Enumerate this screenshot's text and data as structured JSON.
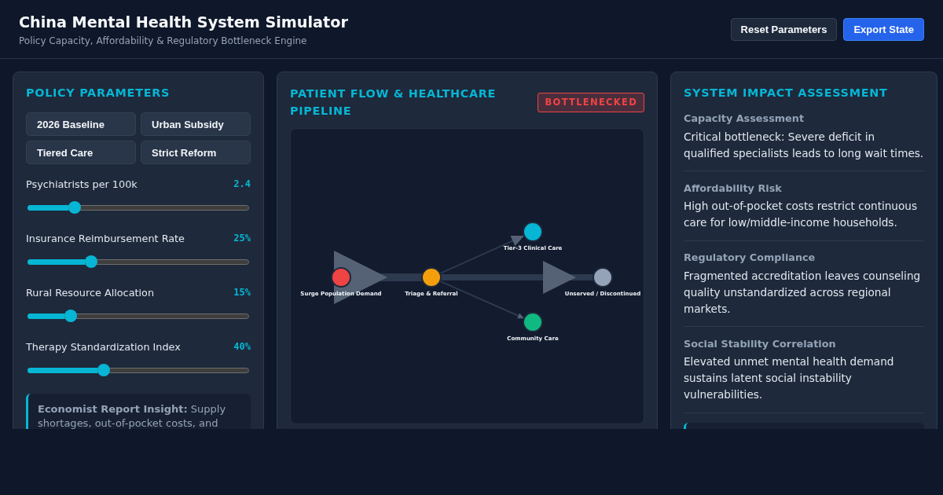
{
  "header": {
    "title": "China Mental Health System Simulator",
    "subtitle": "Policy Capacity, Affordability & Regulatory Bottleneck Engine",
    "buttons": [
      {
        "label": "Reset Parameters",
        "kind": "secondary"
      },
      {
        "label": "Export State",
        "kind": "primary"
      }
    ]
  },
  "policy_parameters": {
    "title": "POLICY PARAMETERS",
    "presets": [
      "2026 Baseline",
      "Urban Subsidy",
      "Tiered Care",
      "Strict Reform"
    ],
    "sliders": [
      {
        "label": "Psychiatrists per 100k",
        "reading": "2.4",
        "level": 0.2
      },
      {
        "label": "Insurance Reimbursement Rate",
        "reading": "25%",
        "level": 0.28
      },
      {
        "label": "Rural Resource Allocation",
        "reading": "15%",
        "level": 0.18
      },
      {
        "label": "Therapy Standardization Index",
        "reading": "40%",
        "level": 0.34
      }
    ],
    "insight": "**Economist Report Insight:** Supply shortages, out-of-pocket costs, and"
  },
  "patient_flow": {
    "title": "PATIENT FLOW & HEALTHCARE PIPELINE",
    "status": {
      "label": "BOTTLENECKED",
      "kind": "critical"
    },
    "nodes": [
      {
        "label": "Surge Population Demand",
        "color": "#ef4444"
      },
      {
        "label": "Triage & Referral",
        "color": "#f59e0b"
      },
      {
        "label": "Tier-3 Clinical Care",
        "color": "#06b6d4"
      },
      {
        "label": "Community Care",
        "color": "#10b981"
      },
      {
        "label": "Unserved / Discontinued",
        "color": "#94a3b8"
      }
    ],
    "links": [
      {
        "kind": "heavy"
      },
      {
        "kind": "light"
      },
      {
        "kind": "light"
      },
      {
        "kind": "heavy"
      }
    ]
  },
  "impact_assessment": {
    "title": "SYSTEM IMPACT ASSESSMENT",
    "sections": [
      {
        "heading": "Capacity Assessment",
        "text": "Critical bottleneck: Severe deficit in qualified specialists leads to long wait times."
      },
      {
        "heading": "Affordability Risk",
        "text": "High out-of-pocket costs restrict continuous care for low/middle-income households."
      },
      {
        "heading": "Regulatory Compliance",
        "text": "Fragmented accreditation leaves counseling quality unstandardized across regional markets."
      },
      {
        "heading": "Social Stability Correlation",
        "text": "Elevated unmet mental health demand sustains latent social instability vulnerabilities."
      }
    ]
  }
}
